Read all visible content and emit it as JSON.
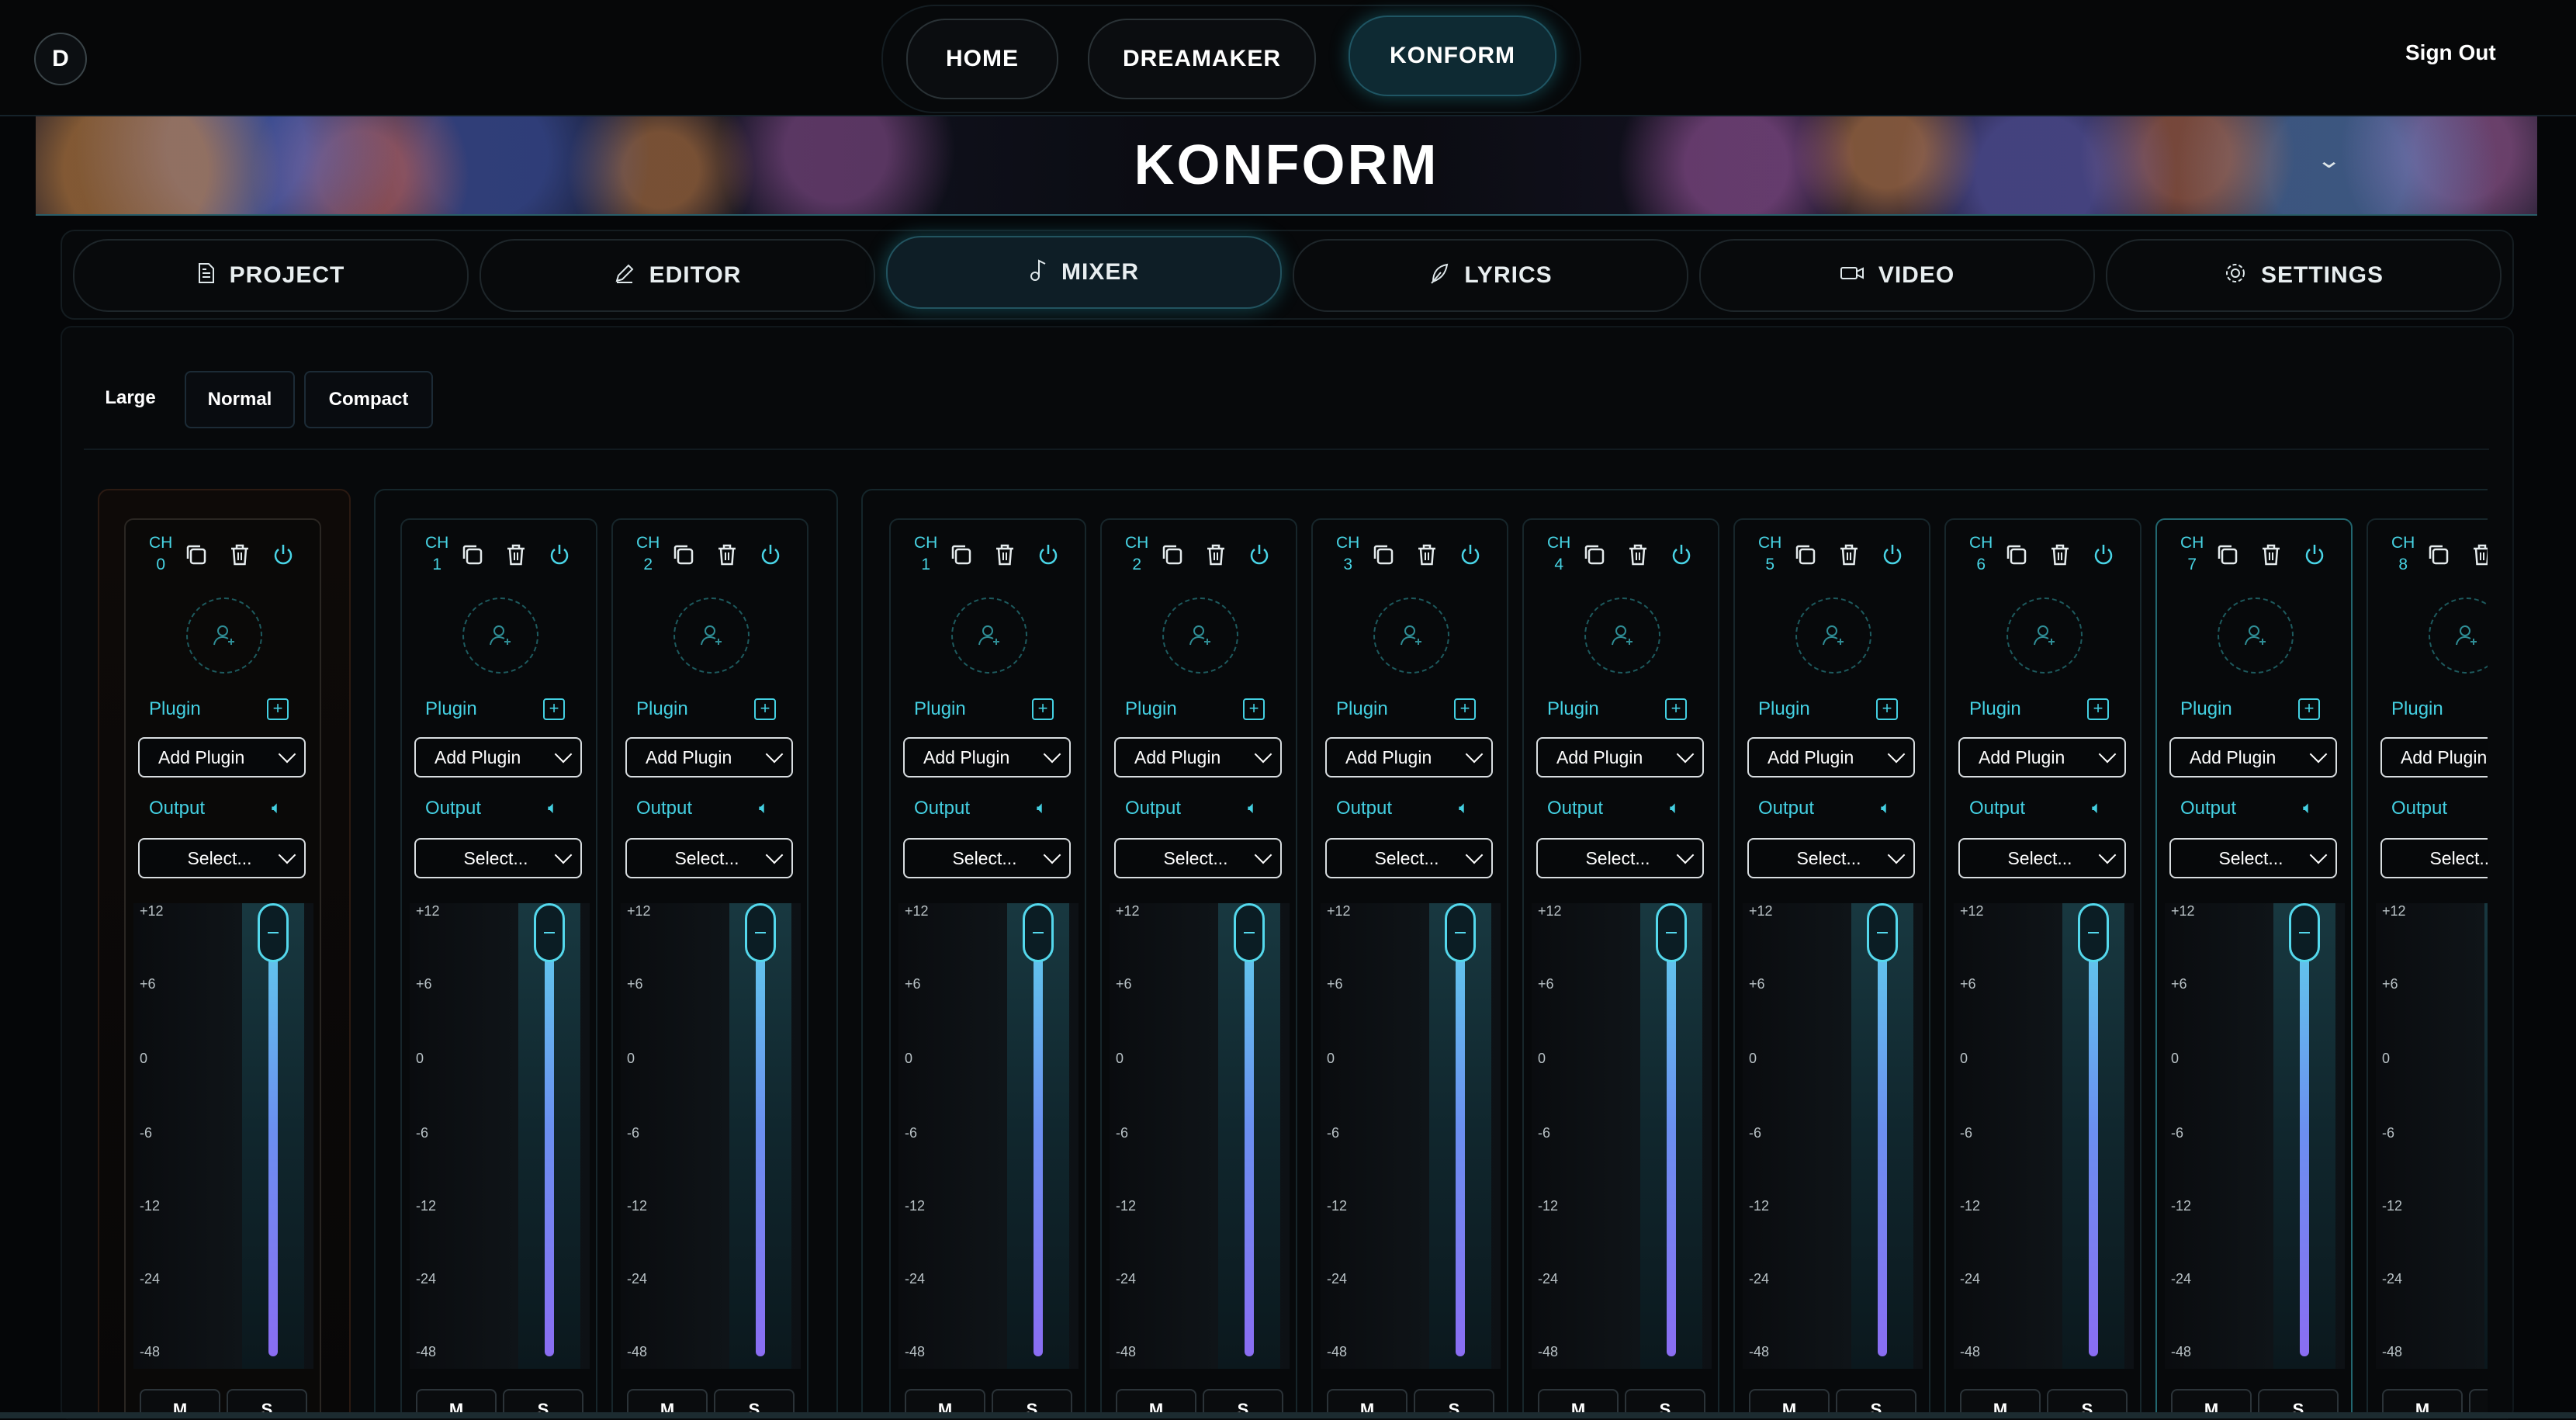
{
  "logo": "D",
  "nav": {
    "items": [
      "HOME",
      "DREAMAKER",
      "KONFORM"
    ],
    "active": "KONFORM",
    "sign_out": "Sign Out"
  },
  "banner": {
    "title": "KONFORM"
  },
  "tabs": [
    {
      "label": "PROJECT",
      "icon": "document-icon"
    },
    {
      "label": "EDITOR",
      "icon": "pencil-icon"
    },
    {
      "label": "MIXER",
      "icon": "music-note-icon",
      "active": true
    },
    {
      "label": "LYRICS",
      "icon": "feather-icon"
    },
    {
      "label": "VIDEO",
      "icon": "video-camera-icon"
    },
    {
      "label": "SETTINGS",
      "icon": "gear-icon"
    }
  ],
  "view_sizes": [
    "Large",
    "Normal",
    "Compact"
  ],
  "channel_prefix": "CH",
  "plugin_label": "Plugin",
  "plugin_placeholder": "Add Plugin",
  "output_label": "Output",
  "output_placeholder": "Select...",
  "meter_scale": [
    "+12",
    "+6",
    "0",
    "-6",
    "-12",
    "-24",
    "-48"
  ],
  "mute_label": "M",
  "solo_label": "S",
  "channels": [
    "0",
    "1",
    "2",
    "1",
    "2",
    "3",
    "4",
    "5",
    "6",
    "7",
    "8"
  ],
  "colors": {
    "accent": "#44d0e2",
    "fader": "#7b7ff0"
  }
}
